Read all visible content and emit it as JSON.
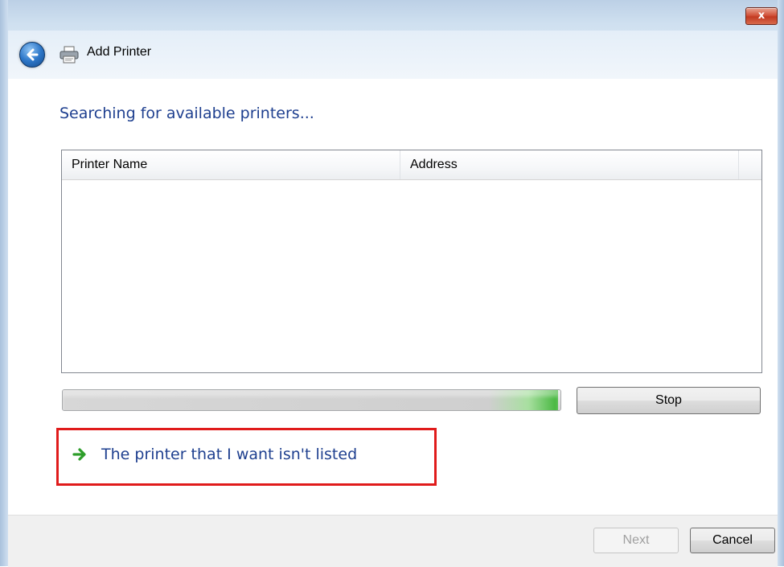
{
  "window": {
    "title": "Add Printer",
    "close_label": "x"
  },
  "content": {
    "heading": "Searching for available printers...",
    "list": {
      "columns": [
        "Printer Name",
        "Address",
        ""
      ],
      "rows": []
    },
    "progress": {
      "value": 0.995
    },
    "stop_label": "Stop",
    "link_label": "The printer that I want isn't listed"
  },
  "footer": {
    "next_label": "Next",
    "next_enabled": false,
    "cancel_label": "Cancel"
  },
  "colors": {
    "heading": "#1e3f8f",
    "highlight_border": "#e01b1b",
    "progress_green": "#41b53a"
  },
  "icons": {
    "back": "back-arrow-icon",
    "printer": "printer-icon",
    "link": "green-arrow-icon",
    "close": "close-icon"
  }
}
